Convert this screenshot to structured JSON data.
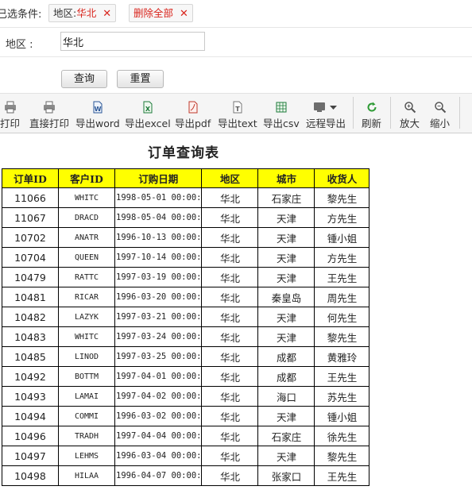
{
  "filter": {
    "label": "已选条件:",
    "chips": [
      {
        "key": "地区:",
        "value": "华北",
        "close": "✕"
      },
      {
        "key": "",
        "value": "删除全部",
        "close": "✕"
      }
    ]
  },
  "form": {
    "region_label": "地区 :",
    "region_value": "华北",
    "query_button": "查询",
    "reset_button": "重置"
  },
  "toolbar": {
    "items": [
      {
        "label": "打印",
        "icon": "printer-icon"
      },
      {
        "label": "直接打印",
        "icon": "printer-icon"
      },
      {
        "label": "导出word",
        "icon": "word-icon"
      },
      {
        "label": "导出excel",
        "icon": "excel-icon"
      },
      {
        "label": "导出pdf",
        "icon": "pdf-icon"
      },
      {
        "label": "导出text",
        "icon": "text-file-icon"
      },
      {
        "label": "导出csv",
        "icon": "csv-icon"
      },
      {
        "label": "远程导出",
        "icon": "remote-export-icon"
      },
      {
        "label": "刷新",
        "icon": "refresh-icon"
      },
      {
        "label": "放大",
        "icon": "zoom-in-icon"
      },
      {
        "label": "缩小",
        "icon": "zoom-out-icon"
      }
    ]
  },
  "report": {
    "title": "订单查询表",
    "columns": [
      "订单ID",
      "客户ID",
      "订购日期",
      "地区",
      "城市",
      "收货人"
    ],
    "rows": [
      [
        "11066",
        "WHITC",
        "1998-05-01 00:00:",
        "华北",
        "石家庄",
        "黎先生"
      ],
      [
        "11067",
        "DRACD",
        "1998-05-04 00:00:",
        "华北",
        "天津",
        "方先生"
      ],
      [
        "10702",
        "ANATR",
        "1996-10-13 00:00:",
        "华北",
        "天津",
        "锺小姐"
      ],
      [
        "10704",
        "QUEEN",
        "1997-10-14 00:00:",
        "华北",
        "天津",
        "方先生"
      ],
      [
        "10479",
        "RATTC",
        "1997-03-19 00:00:",
        "华北",
        "天津",
        "王先生"
      ],
      [
        "10481",
        "RICAR",
        "1996-03-20 00:00:",
        "华北",
        "秦皇岛",
        "周先生"
      ],
      [
        "10482",
        "LAZYK",
        "1997-03-21 00:00:",
        "华北",
        "天津",
        "何先生"
      ],
      [
        "10483",
        "WHITC",
        "1997-03-24 00:00:",
        "华北",
        "天津",
        "黎先生"
      ],
      [
        "10485",
        "LINOD",
        "1997-03-25 00:00:",
        "华北",
        "成都",
        "黄雅玲"
      ],
      [
        "10492",
        "BOTTM",
        "1997-04-01 00:00:",
        "华北",
        "成都",
        "王先生"
      ],
      [
        "10493",
        "LAMAI",
        "1997-04-02 00:00:",
        "华北",
        "海口",
        "苏先生"
      ],
      [
        "10494",
        "COMMI",
        "1996-03-02 00:00:",
        "华北",
        "天津",
        "锺小姐"
      ],
      [
        "10496",
        "TRADH",
        "1997-04-04 00:00:",
        "华北",
        "石家庄",
        "徐先生"
      ],
      [
        "10497",
        "LEHMS",
        "1996-03-04 00:00:",
        "华北",
        "天津",
        "黎先生"
      ],
      [
        "10498",
        "HILAA",
        "1996-04-07 00:00:",
        "华北",
        "张家口",
        "王先生"
      ]
    ]
  }
}
